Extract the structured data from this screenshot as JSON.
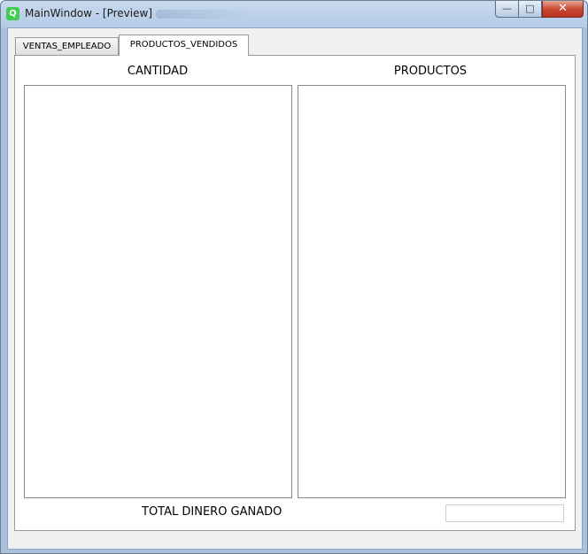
{
  "window": {
    "title": "MainWindow - [Preview]",
    "icon_glyph": "Q",
    "icon": "qt-app-icon",
    "buttons": {
      "minimize_glyph": "—",
      "maximize_glyph": "□",
      "close_glyph": "✕"
    }
  },
  "tabs": [
    {
      "label": "VENTAS_EMPLEADO",
      "selected": false
    },
    {
      "label": "PRODUCTOS_VENDIDOS",
      "selected": true
    }
  ],
  "panel": {
    "cantidad_label": "CANTIDAD",
    "productos_label": "PRODUCTOS",
    "cantidad_items": [],
    "productos_items": [],
    "total_label": "TOTAL DINERO GANADO",
    "total_value": ""
  },
  "colors": {
    "titlebar": "#b4cbe6",
    "close_button": "#c7452d",
    "client_background": "#f0f0f0",
    "qt_icon": "#41cd52"
  }
}
